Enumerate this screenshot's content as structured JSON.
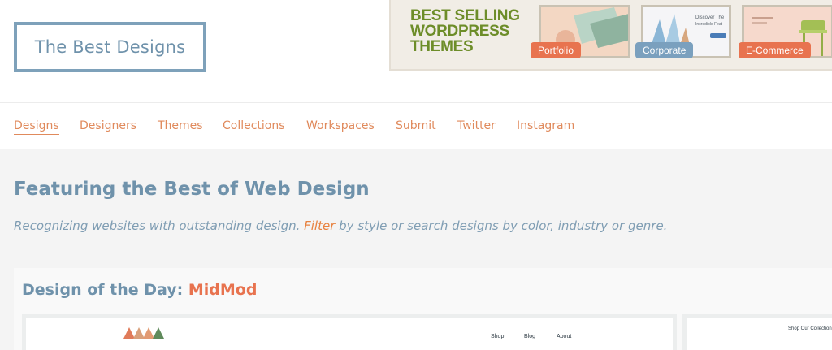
{
  "site": {
    "logo_text": "The Best Designs"
  },
  "banner": {
    "headline": [
      "BEST SELLING",
      "WORDPRESS",
      "THEMES"
    ],
    "tags": {
      "portfolio": "Portfolio",
      "corporate": "Corporate",
      "ecommerce": "E-Commerce"
    },
    "corporate_thumb_text": [
      "Discover The",
      "Incredible Feat"
    ]
  },
  "nav": {
    "items": [
      {
        "label": "Designs",
        "active": true
      },
      {
        "label": "Designers"
      },
      {
        "label": "Themes"
      },
      {
        "label": "Collections"
      },
      {
        "label": "Workspaces"
      },
      {
        "label": "Submit"
      },
      {
        "label": "Twitter"
      },
      {
        "label": "Instagram"
      }
    ]
  },
  "hero": {
    "title": "Featuring the Best of Web Design",
    "subtitle_before": "Recognizing websites with outstanding design. ",
    "subtitle_link": "Filter",
    "subtitle_after": " by style or search designs by color, industry or genre."
  },
  "dotd": {
    "label": "Design of the Day: ",
    "name": "MidMod",
    "preview_nav": [
      "Shop",
      "Blog",
      "About"
    ],
    "side_text": "Shop Our Collection"
  },
  "colors": {
    "accent": "#e8734f",
    "link": "#e08a5c",
    "primary": "#6f92ab",
    "banner_green": "#6d8d29"
  }
}
